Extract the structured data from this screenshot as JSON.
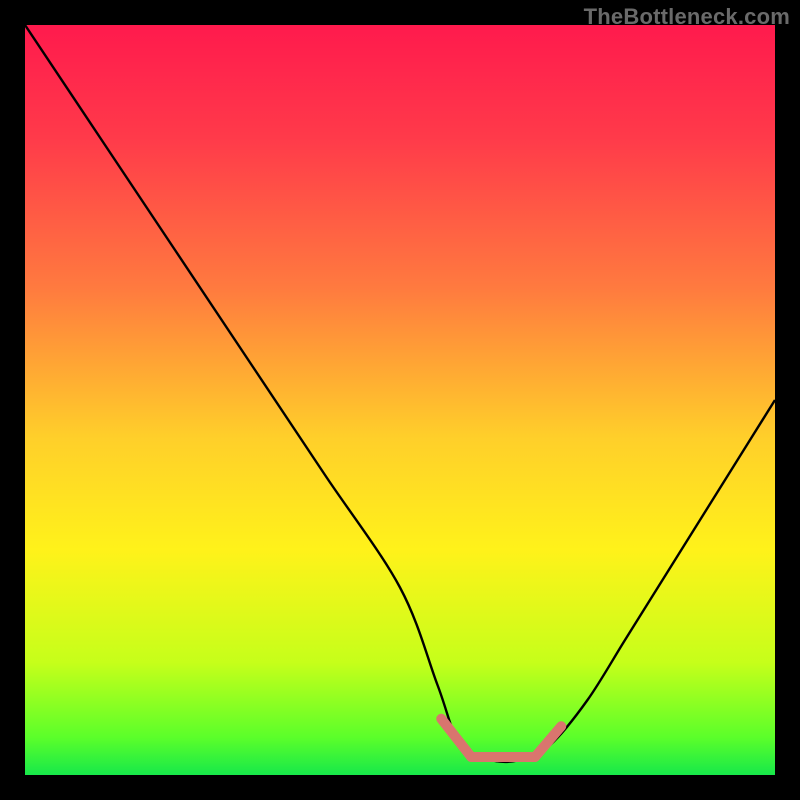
{
  "watermark": "TheBottleneck.com",
  "gradient": {
    "stops": [
      {
        "offset": "0%",
        "color": "#ff1a4d"
      },
      {
        "offset": "15%",
        "color": "#ff3a4a"
      },
      {
        "offset": "35%",
        "color": "#ff7a3f"
      },
      {
        "offset": "55%",
        "color": "#ffcf2a"
      },
      {
        "offset": "70%",
        "color": "#fff21a"
      },
      {
        "offset": "85%",
        "color": "#c6ff1a"
      },
      {
        "offset": "95%",
        "color": "#5bff2a"
      },
      {
        "offset": "100%",
        "color": "#17e84a"
      }
    ]
  },
  "chart_data": {
    "type": "line",
    "title": "",
    "xlabel": "",
    "ylabel": "",
    "xlim": [
      0,
      100
    ],
    "ylim": [
      0,
      100
    ],
    "series": [
      {
        "name": "bottleneck-curve",
        "stroke": "#000000",
        "stroke_width": 2.4,
        "x": [
          0,
          10,
          20,
          30,
          40,
          50,
          55,
          58,
          62,
          66,
          70,
          75,
          80,
          85,
          90,
          95,
          100
        ],
        "y": [
          100,
          85,
          70,
          55,
          40,
          25,
          12,
          4,
          2,
          2,
          4,
          10,
          18,
          26,
          34,
          42,
          50
        ]
      }
    ],
    "segments": [
      {
        "name": "valley-plateau",
        "color": "#d9756e",
        "stroke_width": 10,
        "x": [
          59.5,
          68
        ],
        "y": [
          2.4,
          2.4
        ]
      },
      {
        "name": "valley-left-tip",
        "color": "#d9756e",
        "stroke_width": 10,
        "x": [
          55.5,
          59.5
        ],
        "y": [
          7.5,
          2.4
        ]
      },
      {
        "name": "valley-right-tip",
        "color": "#d9756e",
        "stroke_width": 10,
        "x": [
          68,
          71.5
        ],
        "y": [
          2.4,
          6.5
        ]
      }
    ]
  }
}
